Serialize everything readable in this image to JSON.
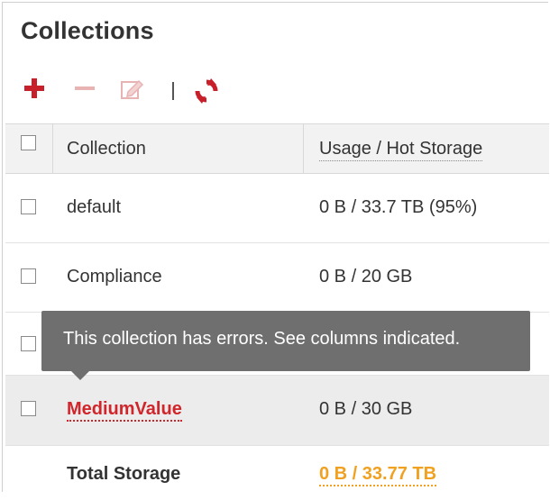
{
  "panel": {
    "title": "Collections"
  },
  "toolbar": {
    "add_icon": "plus-icon",
    "remove_icon": "minus-icon",
    "edit_icon": "edit-icon",
    "refresh_icon": "refresh-icon",
    "colors": {
      "accent": "#c8202a",
      "disabled": "#e8b3b3"
    }
  },
  "table": {
    "headers": {
      "collection": "Collection",
      "usage": "Usage / Hot Storage"
    },
    "rows": [
      {
        "name": "default",
        "usage": "0 B / 33.7 TB (95%)",
        "error": false
      },
      {
        "name": "Compliance",
        "usage": "0 B / 20 GB",
        "error": false
      },
      {
        "name": "MediumValue",
        "usage": "0 B / 30 GB",
        "error": true
      }
    ],
    "total": {
      "label": "Total Storage",
      "value": "0 B / 33.77 TB"
    }
  },
  "tooltip": {
    "text": "This collection has errors. See columns indicated."
  },
  "colors": {
    "error": "#d0262b",
    "warning": "#f0a121",
    "tooltip_bg": "#6f6f6f"
  }
}
